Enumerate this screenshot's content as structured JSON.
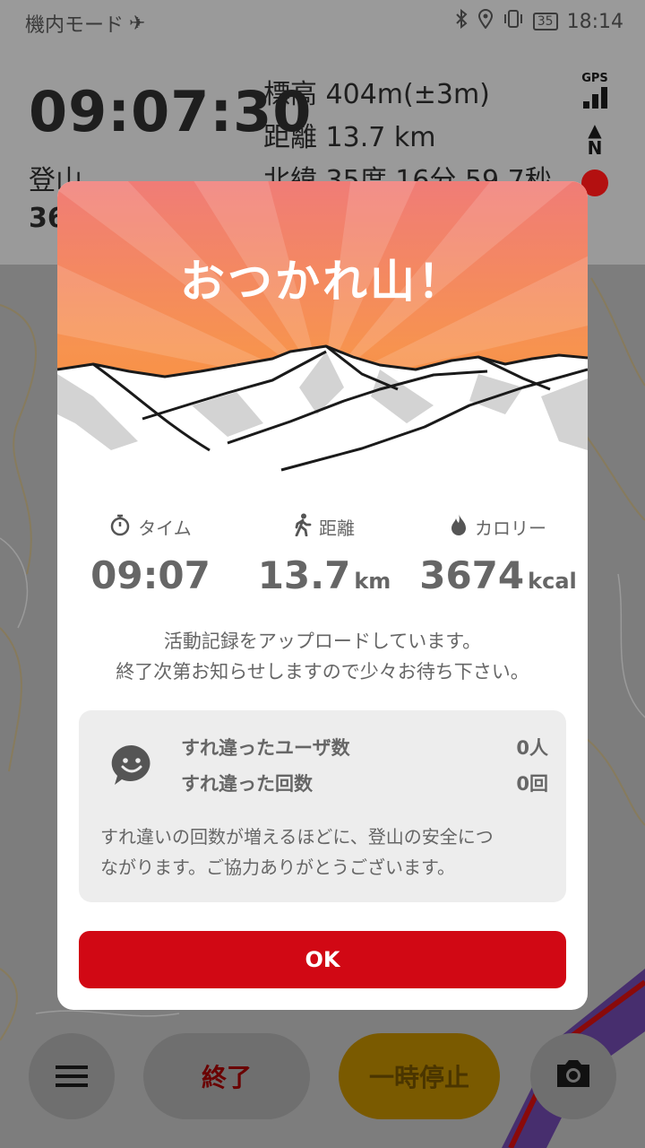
{
  "status_bar": {
    "airplane_mode_label": "機内モード",
    "airplane_icon": "airplane-icon",
    "bluetooth_icon": "bluetooth-icon",
    "location_icon": "location-icon",
    "vibrate_icon": "vibrate-icon",
    "battery": "35",
    "time": "18:14"
  },
  "tracker": {
    "elapsed": "09:07:30",
    "mode": "登山",
    "mode_sub": "36",
    "altitude": "標高 404m(±3m)",
    "distance": "距離 13.7 km",
    "latitude": "北緯 35度 16分 59.7秒",
    "gps_label": "GPS",
    "compass_label": "N"
  },
  "dialog": {
    "title": "おつかれ山！",
    "stats": {
      "time_label": "タイム",
      "time_value": "09:07",
      "distance_label": "距離",
      "distance_value": "13.7",
      "distance_unit": "km",
      "calorie_label": "カロリー",
      "calorie_value": "3674",
      "calorie_unit": "kcal"
    },
    "upload_line1": "活動記録をアップロードしています。",
    "upload_line2": "終了次第お知らせしますので少々お待ち下さい。",
    "passing": {
      "users_label": "すれ違ったユーザ数",
      "users_value": "0人",
      "count_label": "すれ違った回数",
      "count_value": "0回",
      "note_line1": "すれ違いの回数が増えるほどに、登山の安全につ",
      "note_line2": "ながります。ご協力ありがとうございます。"
    },
    "ok_label": "OK"
  },
  "bottom_bar": {
    "end_label": "終了",
    "pause_label": "一時停止"
  },
  "colors": {
    "accent_red": "#d10814",
    "banner_top": "#f07c77",
    "banner_bottom": "#fb8a2a"
  }
}
